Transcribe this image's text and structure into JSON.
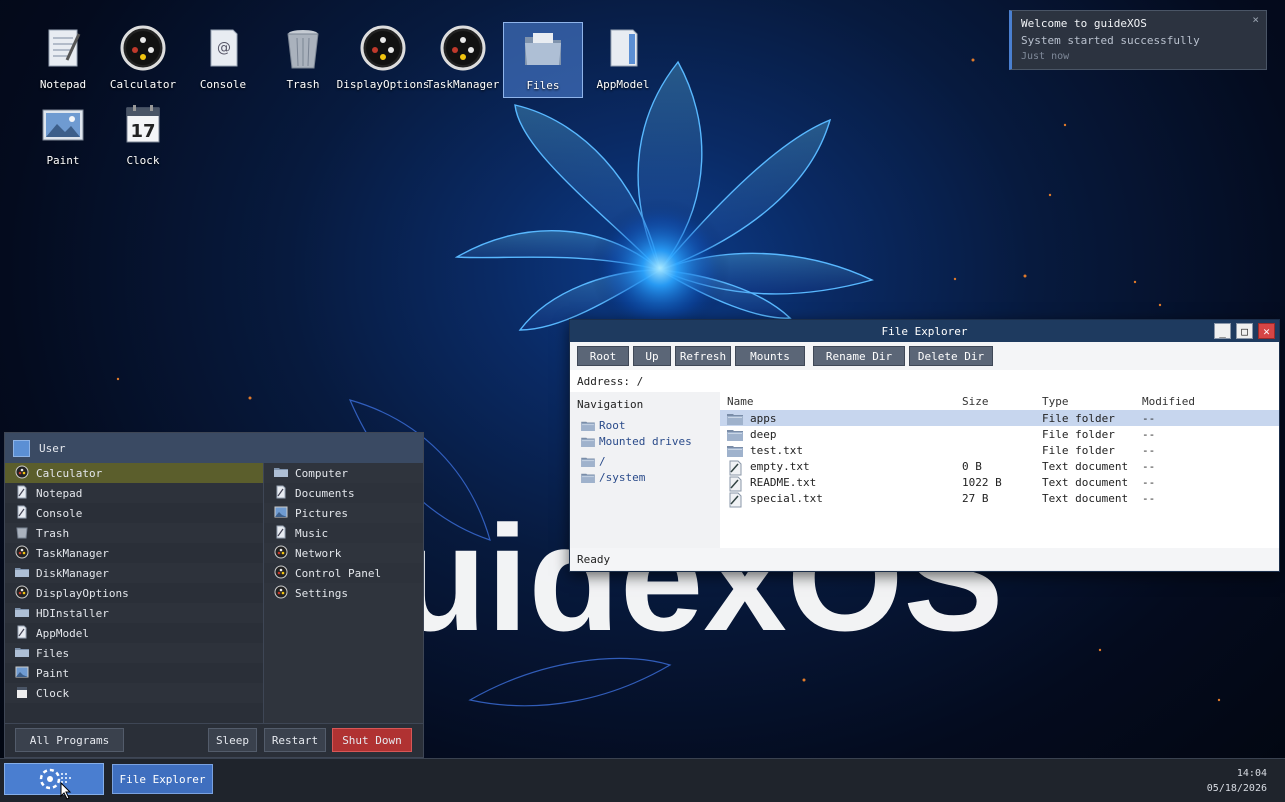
{
  "desktop": {
    "wallpaper_text": "uidexOS",
    "icons": [
      {
        "label": "Notepad",
        "icon": "notepad-icon"
      },
      {
        "label": "Calculator",
        "icon": "calculator-icon"
      },
      {
        "label": "Console",
        "icon": "console-icon"
      },
      {
        "label": "Trash",
        "icon": "trash-icon"
      },
      {
        "label": "DisplayOptions",
        "icon": "display-options-icon"
      },
      {
        "label": "TaskManager",
        "icon": "task-manager-icon"
      },
      {
        "label": "Files",
        "icon": "files-icon",
        "selected": true
      },
      {
        "label": "AppModel",
        "icon": "app-model-icon"
      },
      {
        "label": "Paint",
        "icon": "paint-icon"
      },
      {
        "label": "Clock",
        "icon": "clock-icon",
        "day": "17"
      }
    ]
  },
  "notification": {
    "title": "Welcome to guideXOS",
    "message": "System started successfully",
    "time": "Just now",
    "close": "×"
  },
  "explorer": {
    "title": "File Explorer",
    "controls": {
      "minimize": "_",
      "maximize": "□",
      "close": "✕"
    },
    "toolbar": [
      "Root",
      "Up",
      "Refresh",
      "Mounts",
      "Rename Dir",
      "Delete Dir"
    ],
    "address": "Address: /",
    "nav_heading": "Navigation",
    "nav_items": [
      "Root",
      "Mounted drives",
      "/",
      "/system"
    ],
    "columns": [
      "Name",
      "Size",
      "Type",
      "Modified"
    ],
    "rows": [
      {
        "name": "apps",
        "size": "",
        "type": "File folder",
        "modified": "--",
        "kind": "folder"
      },
      {
        "name": "deep",
        "size": "",
        "type": "File folder",
        "modified": "--",
        "kind": "folder"
      },
      {
        "name": "test.txt",
        "size": "",
        "type": "File folder",
        "modified": "--",
        "kind": "folder"
      },
      {
        "name": "empty.txt",
        "size": "0 B",
        "type": "Text document",
        "modified": "--",
        "kind": "file"
      },
      {
        "name": "README.txt",
        "size": "1022 B",
        "type": "Text document",
        "modified": "--",
        "kind": "file"
      },
      {
        "name": "special.txt",
        "size": "27 B",
        "type": "Text document",
        "modified": "--",
        "kind": "file"
      }
    ],
    "status": "Ready"
  },
  "start_menu": {
    "user": "User",
    "programs": [
      "Calculator",
      "Notepad",
      "Console",
      "Trash",
      "TaskManager",
      "DiskManager",
      "DisplayOptions",
      "HDInstaller",
      "AppModel",
      "Files",
      "Paint",
      "Clock"
    ],
    "places": [
      "Computer",
      "Documents",
      "Pictures",
      "Music",
      "Network",
      "Control Panel",
      "Settings"
    ],
    "all_programs": "All Programs",
    "sleep": "Sleep",
    "restart": "Restart",
    "shutdown": "Shut Down"
  },
  "taskbar": {
    "task": "File Explorer",
    "time": "14:04",
    "date": "05/18/2026"
  },
  "colors": {
    "accent": "#4a7ed0",
    "titlebar": "#1e3a5f",
    "shutdown": "#b03232",
    "highlight": "#5b5e2c"
  }
}
